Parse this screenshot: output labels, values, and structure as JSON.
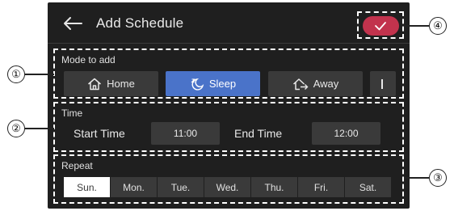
{
  "header": {
    "title": "Add Schedule"
  },
  "mode": {
    "label": "Mode to add",
    "buttons": [
      {
        "label": "Home",
        "icon": "home-icon",
        "selected": false
      },
      {
        "label": "Sleep",
        "icon": "moon-icon",
        "selected": true
      },
      {
        "label": "Away",
        "icon": "away-icon",
        "selected": false
      }
    ]
  },
  "time": {
    "label": "Time",
    "start_label": "Start Time",
    "start_value": "11:00",
    "end_label": "End Time",
    "end_value": "12:00"
  },
  "repeat": {
    "label": "Repeat",
    "days": [
      {
        "label": "Sun.",
        "selected": true
      },
      {
        "label": "Mon.",
        "selected": false
      },
      {
        "label": "Tue.",
        "selected": false
      },
      {
        "label": "Wed.",
        "selected": false
      },
      {
        "label": "Thu.",
        "selected": false
      },
      {
        "label": "Fri.",
        "selected": false
      },
      {
        "label": "Sat.",
        "selected": false
      }
    ]
  },
  "callouts": [
    "①",
    "②",
    "③",
    "④"
  ],
  "colors": {
    "background": "#1f1f1f",
    "selected_mode": "#4a73c9",
    "confirm": "#c2334d",
    "button": "#3a3a3a"
  }
}
